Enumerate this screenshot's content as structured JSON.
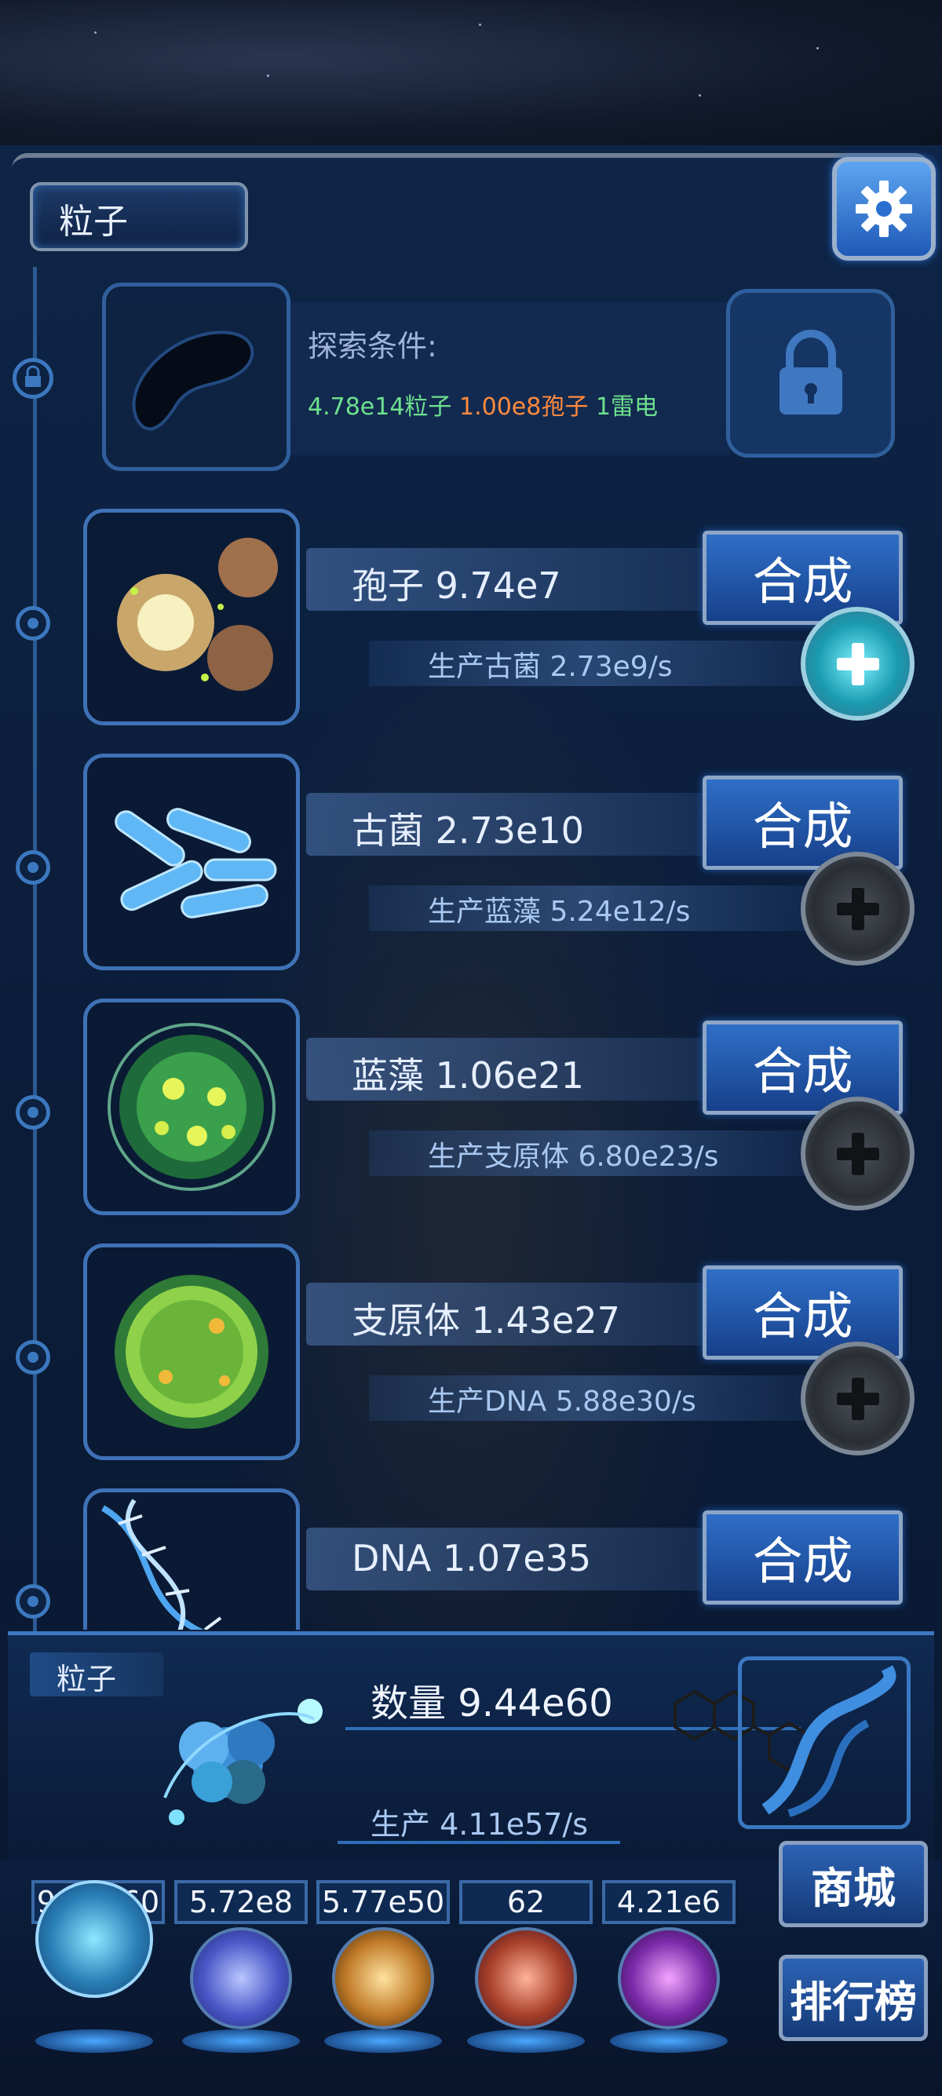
{
  "header": {
    "title": "粒子",
    "settings_icon": "gear-icon"
  },
  "locked_item": {
    "explore_label": "探索条件:",
    "requirements": [
      {
        "text": "4.78e14粒子",
        "color": "#6de08e"
      },
      {
        "text": "1.00e8孢子",
        "color": "#ff8a3d"
      },
      {
        "text": "1雷电",
        "color": "#6de08e"
      }
    ],
    "lock_icon": "padlock-icon"
  },
  "items": [
    {
      "name": "孢子 9.74e7",
      "production": "生产古菌 2.73e9/s",
      "synth_label": "合成",
      "upgrade_active": true,
      "icon": "spore-icon"
    },
    {
      "name": "古菌 2.73e10",
      "production": "生产蓝藻 5.24e12/s",
      "synth_label": "合成",
      "upgrade_active": false,
      "icon": "archaea-icon"
    },
    {
      "name": "蓝藻 1.06e21",
      "production": "生产支原体 6.80e23/s",
      "synth_label": "合成",
      "upgrade_active": false,
      "icon": "cyanobacteria-icon"
    },
    {
      "name": "支原体 1.43e27",
      "production": "生产DNA 5.88e30/s",
      "synth_label": "合成",
      "upgrade_active": false,
      "icon": "mycoplasma-icon"
    },
    {
      "name": "DNA 1.07e35",
      "production": "",
      "synth_label": "合成",
      "upgrade_active": false,
      "icon": "dna-icon"
    }
  ],
  "info_panel": {
    "tab_label": "粒子",
    "quantity": "数量 9.44e60",
    "rate": "生产 4.11e57/s",
    "icons": [
      "particle-cluster-icon",
      "molecule-icon",
      "dna-helix-icon"
    ]
  },
  "currencies": [
    {
      "value": "9.44e60",
      "icon": "particle-orb-icon"
    },
    {
      "value": "5.72e8",
      "icon": "lightning-orb-icon"
    },
    {
      "value": "5.77e50",
      "icon": "galaxy-orb-icon"
    },
    {
      "value": "62",
      "icon": "brain-orb-icon"
    },
    {
      "value": "4.21e6",
      "icon": "vortex-orb-icon"
    }
  ],
  "side_buttons": {
    "shop": "商城",
    "ranking": "排行榜"
  },
  "colors": {
    "accent": "#2f6fc8",
    "req_green": "#6de08e",
    "req_orange": "#ff8a3d"
  }
}
